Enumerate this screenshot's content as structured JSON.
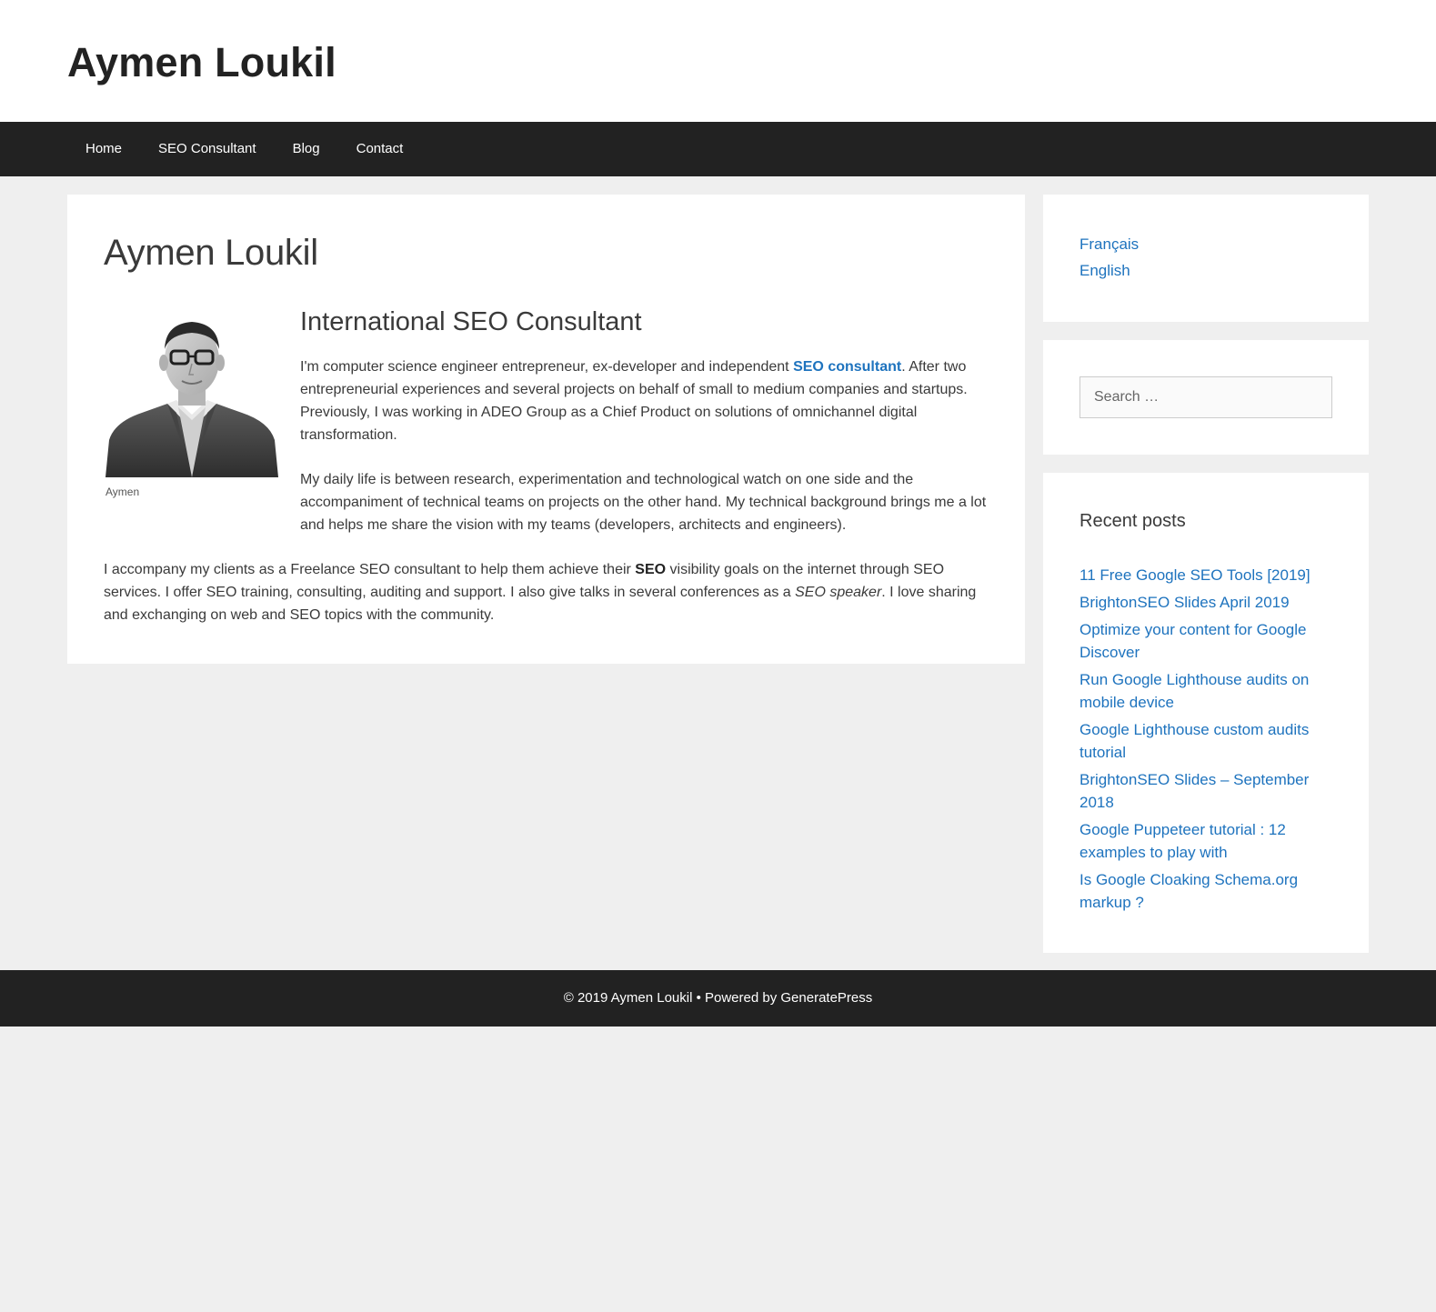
{
  "site": {
    "title": "Aymen Loukil"
  },
  "nav": {
    "items": [
      {
        "label": "Home"
      },
      {
        "label": "SEO Consultant"
      },
      {
        "label": "Blog"
      },
      {
        "label": "Contact"
      }
    ]
  },
  "main": {
    "page_title": "Aymen Loukil",
    "photo_caption": "Aymen",
    "subtitle": "International SEO Consultant",
    "para1": {
      "before_link": "I'm computer science engineer entrepreneur, ex-developer and independent ",
      "link_text": "SEO consultant",
      "after_link": ". After two entrepreneurial experiences and several projects on behalf of small to medium companies and startups. Previously, I was working in ADEO Group as a Chief Product on solutions of omnichannel digital transformation."
    },
    "para2": "My daily life is between research, experimentation and technological watch on one side and the accompaniment of technical teams on projects on the other hand. My technical background brings me a lot and helps me share the vision with my teams (developers, architects and engineers).",
    "para3": {
      "part1": "I accompany my clients as a Freelance SEO consultant to help them achieve their ",
      "bold": "SEO",
      "part2": " visibility goals on the internet through SEO services. I offer SEO training, consulting, auditing and support. I also give talks in several conferences as a ",
      "italic": "SEO speaker",
      "part3": ". I love sharing and exchanging on web and SEO topics with the community."
    }
  },
  "sidebar": {
    "languages": [
      {
        "label": "Français"
      },
      {
        "label": "English"
      }
    ],
    "search": {
      "placeholder": "Search …"
    },
    "recent": {
      "title": "Recent posts",
      "posts": [
        {
          "label": "11 Free Google SEO Tools [2019]"
        },
        {
          "label": "BrightonSEO Slides April 2019"
        },
        {
          "label": "Optimize your content for Google Discover"
        },
        {
          "label": "Run Google Lighthouse audits on mobile device"
        },
        {
          "label": "Google Lighthouse custom audits tutorial"
        },
        {
          "label": "BrightonSEO Slides – September 2018"
        },
        {
          "label": "Google Puppeteer tutorial : 12 examples to play with"
        },
        {
          "label": "Is Google Cloaking Schema.org markup ?"
        }
      ]
    }
  },
  "footer": {
    "text": "© 2019 Aymen Loukil • Powered by GeneratePress"
  },
  "colors": {
    "link": "#1e73be",
    "nav_bg": "#222222",
    "page_bg": "#efefef"
  }
}
